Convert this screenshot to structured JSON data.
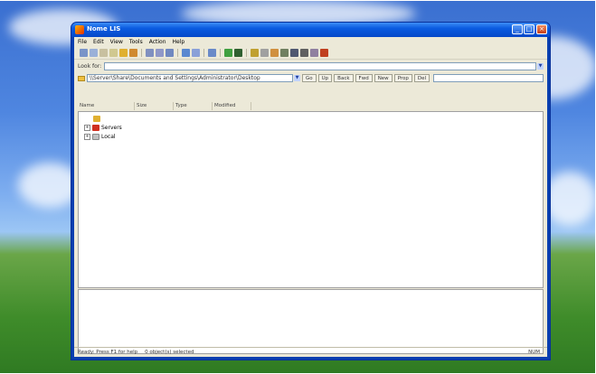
{
  "window": {
    "title": "Nome LIS",
    "minimize_label": "_",
    "maximize_label": "□",
    "close_label": "×"
  },
  "menu": [
    "File",
    "Edit",
    "View",
    "Tools",
    "Action",
    "Help"
  ],
  "toolbar_icons": [
    {
      "name": "open-icon",
      "color": "#7a94c8"
    },
    {
      "name": "save-icon",
      "color": "#9ab0d8"
    },
    {
      "name": "cut-icon",
      "color": "#c8c0a0"
    },
    {
      "name": "copy-icon",
      "color": "#d0c890"
    },
    {
      "name": "filter-icon",
      "color": "#e0b030"
    },
    {
      "name": "refresh-icon",
      "color": "#d08a30"
    },
    {
      "name": "sep"
    },
    {
      "name": "grid-icon",
      "color": "#8090c0"
    },
    {
      "name": "list-icon",
      "color": "#9098c8"
    },
    {
      "name": "details-icon",
      "color": "#7088c0"
    },
    {
      "name": "sep"
    },
    {
      "name": "connect-icon",
      "color": "#5a88d0"
    },
    {
      "name": "disconnect-icon",
      "color": "#8aa0d8"
    },
    {
      "name": "sep"
    },
    {
      "name": "tag-icon",
      "color": "#6a8ac8"
    },
    {
      "name": "sep"
    },
    {
      "name": "home-icon",
      "color": "#40a040"
    },
    {
      "name": "stop-icon",
      "color": "#306030"
    },
    {
      "name": "sep"
    },
    {
      "name": "pencil-icon",
      "color": "#c0a030"
    },
    {
      "name": "search-icon",
      "color": "#a0a0a0"
    },
    {
      "name": "chart-icon",
      "color": "#d09040"
    },
    {
      "name": "table-icon",
      "color": "#708060"
    },
    {
      "name": "monitor-icon",
      "color": "#505870"
    },
    {
      "name": "printer-icon",
      "color": "#606060"
    },
    {
      "name": "mail-icon",
      "color": "#9080a0"
    },
    {
      "name": "settings-icon",
      "color": "#c04020"
    }
  ],
  "search": {
    "label": "Look for:",
    "value": ""
  },
  "location": {
    "value": "\\\\Server\\Share\\Documents and Settings\\Administrator\\Desktop",
    "buttons": [
      "Go",
      "Up",
      "Back",
      "Fwd",
      "New",
      "Prop",
      "Del"
    ]
  },
  "columns": [
    "Name",
    "Size",
    "Type",
    "Modified"
  ],
  "tree": [
    {
      "label": "",
      "icon_color": "#e0b030",
      "expander": ""
    },
    {
      "label": "Servers",
      "icon_color": "#d03020",
      "expander": "+"
    },
    {
      "label": "Local",
      "icon_color": "#c0c0c0",
      "expander": "+"
    }
  ],
  "status": {
    "left": "Ready: Press F1 for help",
    "middle": "0 object(s) selected",
    "right": "NUM"
  }
}
